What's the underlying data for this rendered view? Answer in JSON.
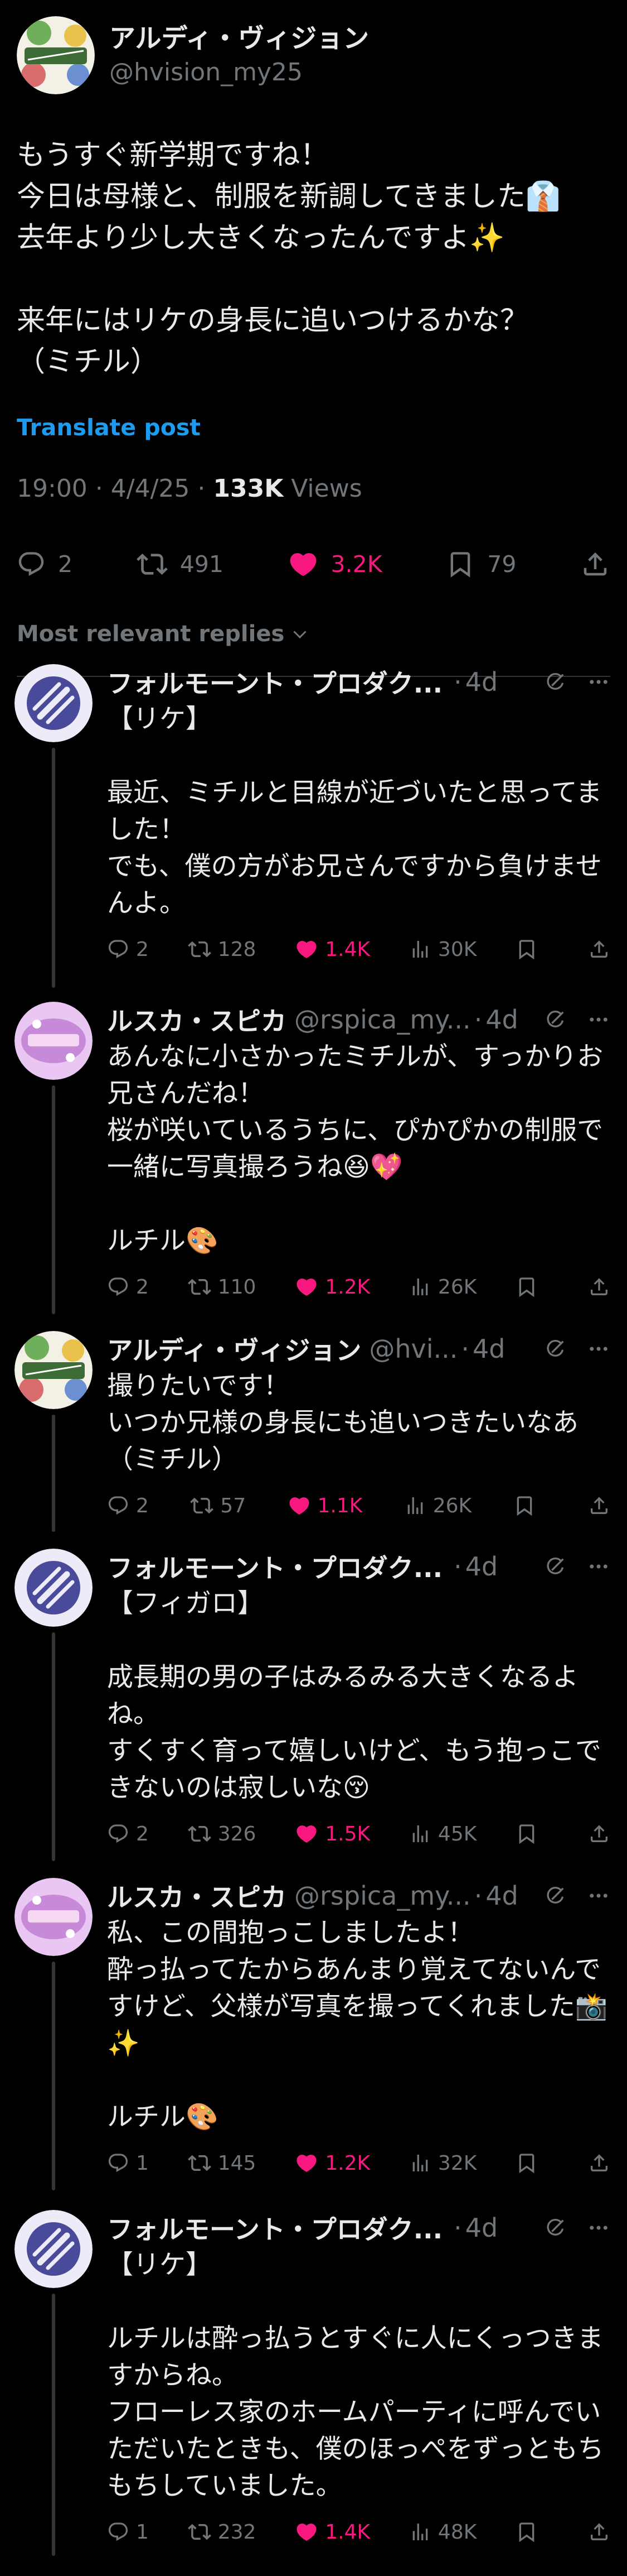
{
  "post": {
    "display_name": "アルディ・ヴィジョン",
    "handle": "@hvision_my25",
    "text": "もうすぐ新学期ですね！\n今日は母様と、制服を新調してきました👔\n去年より少し大きくなったんですよ✨\n\n来年にはリケの身長に追いつけるかな？\n（ミチル）",
    "translate_label": "Translate post",
    "timestamp": "19:00 · 4/4/25 · ",
    "views_count": "133K",
    "views_label": " Views",
    "stats": {
      "replies": "2",
      "reposts": "491",
      "likes": "3.2K",
      "bookmarks": "79"
    }
  },
  "sort_label": "Most relevant replies",
  "icons": {
    "reply": "reply-icon",
    "repost": "repost-icon",
    "like": "heart-icon",
    "views": "views-icon",
    "bookmark": "bookmark-icon",
    "share": "share-icon",
    "grok": "grok-icon",
    "more": "more-icon",
    "chevron": "chevron-down-icon"
  },
  "colors": {
    "accent": "#1d9bf0",
    "like": "#f91880",
    "muted": "#71767b"
  },
  "replies": [
    {
      "name": "フォルモーント・プロダク...",
      "handle": "",
      "time": "4d",
      "text": "【リケ】\n\n最近、ミチルと目線が近づいたと思ってました！\nでも、僕の方がお兄さんですから負けませんよ。",
      "replies": "2",
      "reposts": "128",
      "likes": "1.4K",
      "views": "30K"
    },
    {
      "name": "ルスカ・スピカ",
      "handle": "@rspica_my...",
      "time": "4d",
      "text": "あんなに小さかったミチルが、すっかりお兄さんだね！\n桜が咲いているうちに、ぴかぴかの制服で一緒に写真撮ろうね😆💖\n\nルチル🎨",
      "replies": "2",
      "reposts": "110",
      "likes": "1.2K",
      "views": "26K"
    },
    {
      "name": "アルディ・ヴィジョン",
      "handle": "@hvi...",
      "time": "4d",
      "text": "撮りたいです！\nいつか兄様の身長にも追いつきたいなあ（ミチル）",
      "replies": "2",
      "reposts": "57",
      "likes": "1.1K",
      "views": "26K"
    },
    {
      "name": "フォルモーント・プロダク...",
      "handle": "",
      "time": "4d",
      "text": "【フィガロ】\n\n成長期の男の子はみるみる大きくなるよね。\nすくすく育って嬉しいけど、もう抱っこできないのは寂しいな😚",
      "replies": "2",
      "reposts": "326",
      "likes": "1.5K",
      "views": "45K"
    },
    {
      "name": "ルスカ・スピカ",
      "handle": "@rspica_my...",
      "time": "4d",
      "text": "私、この間抱っこしましたよ！\n酔っ払ってたからあんまり覚えてないんですけど、父様が写真を撮ってくれました📸✨\n\nルチル🎨",
      "replies": "1",
      "reposts": "145",
      "likes": "1.2K",
      "views": "32K"
    },
    {
      "name": "フォルモーント・プロダク...",
      "handle": "",
      "time": "4d",
      "text": "【リケ】\n\nルチルは酔っ払うとすぐに人にくっつきますからね。\nフローレス家のホームパーティに呼んでいただいたときも、僕のほっぺをずっともちもちしていました。",
      "replies": "1",
      "reposts": "232",
      "likes": "1.4K",
      "views": "48K"
    }
  ]
}
